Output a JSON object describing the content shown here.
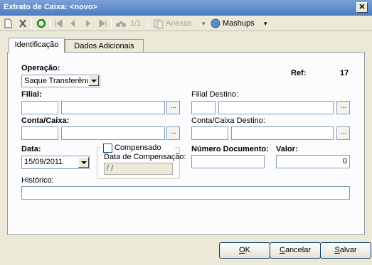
{
  "window": {
    "title": "Extrato de Caixa: <novo>",
    "close_glyph": "✕"
  },
  "toolbar": {
    "record_position": "1/1",
    "attachments_label": "Anexos",
    "mashups_label": "Mashups"
  },
  "tabs": [
    {
      "label": "Identificação",
      "active": true
    },
    {
      "label": "Dados Adicionais",
      "active": false
    }
  ],
  "form": {
    "operacao_label": "Operação:",
    "operacao_value": "Saque Transferência",
    "ref_label": "Ref:",
    "ref_value": "17",
    "filial_label": "Filial:",
    "filial_code": "",
    "filial_name": "",
    "filial_destino_label": "Filial Destino:",
    "filial_destino_code": "",
    "filial_destino_name": "",
    "conta_label": "Conta/Caixa:",
    "conta_code": "",
    "conta_name": "",
    "conta_destino_label": "Conta/Caixa Destino:",
    "conta_destino_code": "",
    "conta_destino_name": "",
    "lookup_glyph": "...",
    "data_label": "Data:",
    "data_value": "15/09/2011",
    "compensado_label": "Compensado",
    "data_compensacao_label": "Data de Compensação:",
    "data_compensacao_value": "/ /",
    "numero_documento_label": "Número Documento:",
    "numero_documento_value": "",
    "valor_label": "Valor:",
    "valor_value": "0",
    "historico_label": "Histórico:",
    "historico_value": ""
  },
  "buttons": {
    "ok_prefix": "",
    "ok_hot": "O",
    "ok_rest": "K",
    "cancel_hot": "C",
    "cancel_rest": "ancelar",
    "save_hot": "S",
    "save_rest": "alvar"
  }
}
